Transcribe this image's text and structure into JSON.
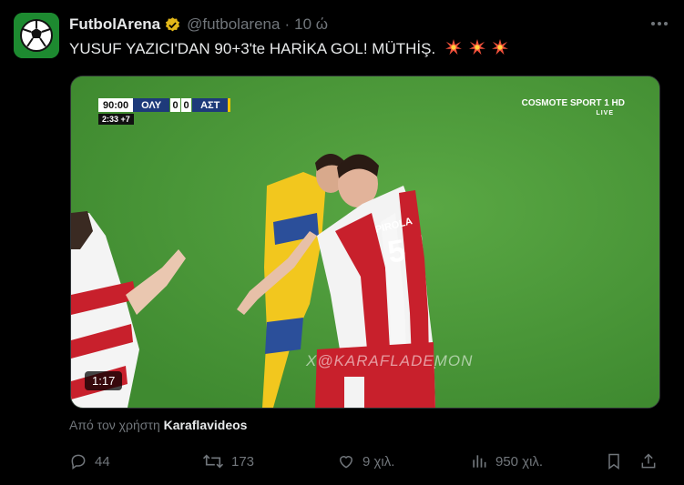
{
  "tweet": {
    "author_name": "FutbolArena",
    "handle": "@futbolarena",
    "separator": "·",
    "time": "10 ώ",
    "text": "YUSUF YAZICI'DAN 90+3'te HARİKA GOL! MÜTHİŞ.",
    "emojis": [
      "collision-emoji",
      "collision-emoji",
      "collision-emoji"
    ]
  },
  "media": {
    "scorebug": {
      "clock": "90:00",
      "home_team": "ΟΛΥ",
      "home_score": "0",
      "away_score": "0",
      "away_team": "ΑΣΤ",
      "extra": "2:33 +7"
    },
    "broadcaster": "COSMOTE SPORT 1 HD",
    "broadcaster_sub": "LIVE",
    "watermark": "X@KARAFLADEMON",
    "jersey_name": "PIROLA",
    "jersey_number": "5",
    "duration": "1:17"
  },
  "source": {
    "prefix": "Από τον χρήστη",
    "user": "Karaflavideos"
  },
  "actions": {
    "replies": "44",
    "reposts": "173",
    "likes": "9 χιλ.",
    "views": "950 χιλ."
  },
  "colors": {
    "background": "#000000",
    "text": "#e7e9ea",
    "muted": "#71767b",
    "verified": "#e2b719",
    "pitch": "#4d9a3a"
  }
}
